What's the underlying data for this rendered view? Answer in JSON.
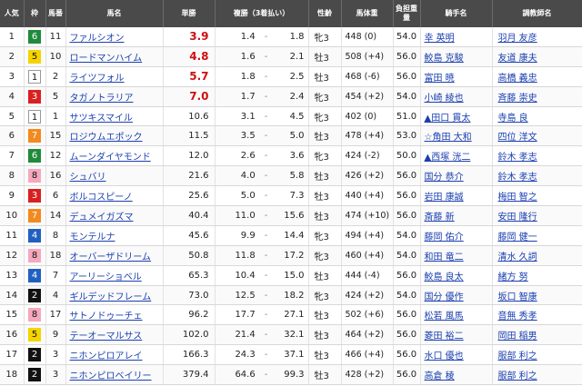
{
  "headers": {
    "rank": "人気",
    "waku": "枠",
    "umaban": "馬番",
    "horse": "馬名",
    "win": "単勝",
    "place": "複勝（3着払い）",
    "sex_age": "性齢",
    "weight": "馬体重",
    "kinryo": "負担重量",
    "jockey": "騎手名",
    "trainer": "調教師名"
  },
  "colors": {
    "waku1": "#ffffff",
    "waku2": "#111111",
    "waku3": "#d92020",
    "waku4": "#2060c0",
    "waku5": "#f5d300",
    "waku6": "#1f8a3a",
    "waku7": "#f28a1e",
    "waku8": "#f5a8be",
    "header_bg": "#4a4a4a",
    "odds_red": "#cc1111",
    "link": "#1a3fb0"
  },
  "rows": [
    {
      "rank": "1",
      "waku": "6",
      "umaban": "11",
      "horse": "ファルシオン",
      "win": "3.9",
      "place_lo": "1.4",
      "place_hi": "1.8",
      "sex_age": "牝3",
      "weight": "448 (0)",
      "kinryo": "54.0",
      "jockey": "幸 英明",
      "trainer": "羽月 友彦"
    },
    {
      "rank": "2",
      "waku": "5",
      "umaban": "10",
      "horse": "ロードマンハイム",
      "win": "4.8",
      "place_lo": "1.6",
      "place_hi": "2.1",
      "sex_age": "牡3",
      "weight": "508 (+4)",
      "kinryo": "56.0",
      "jockey": "鮫島 克駿",
      "trainer": "友道 康夫"
    },
    {
      "rank": "3",
      "waku": "1",
      "umaban": "2",
      "horse": "ライツフォル",
      "win": "5.7",
      "place_lo": "1.8",
      "place_hi": "2.5",
      "sex_age": "牡3",
      "weight": "468 (-6)",
      "kinryo": "56.0",
      "jockey": "富田 暁",
      "trainer": "高橋 義忠"
    },
    {
      "rank": "4",
      "waku": "3",
      "umaban": "5",
      "horse": "タガノトラリア",
      "win": "7.0",
      "place_lo": "1.7",
      "place_hi": "2.4",
      "sex_age": "牝3",
      "weight": "454 (+2)",
      "kinryo": "54.0",
      "jockey": "小崎 綾也",
      "trainer": "斉藤 崇史"
    },
    {
      "rank": "5",
      "waku": "1",
      "umaban": "1",
      "horse": "サツキスマイル",
      "win": "10.6",
      "place_lo": "3.1",
      "place_hi": "4.5",
      "sex_age": "牝3",
      "weight": "402 (0)",
      "kinryo": "51.0",
      "jockey": "▲田口 貫太",
      "trainer": "寺島 良"
    },
    {
      "rank": "6",
      "waku": "7",
      "umaban": "15",
      "horse": "ロジウムエポック",
      "win": "11.5",
      "place_lo": "3.5",
      "place_hi": "5.0",
      "sex_age": "牡3",
      "weight": "478 (+4)",
      "kinryo": "53.0",
      "jockey": "☆角田 大和",
      "trainer": "四位 洋文"
    },
    {
      "rank": "7",
      "waku": "6",
      "umaban": "12",
      "horse": "ムーンダイヤモンド",
      "win": "12.0",
      "place_lo": "2.6",
      "place_hi": "3.6",
      "sex_age": "牝3",
      "weight": "424 (-2)",
      "kinryo": "50.0",
      "jockey": "▲西塚 洸二",
      "trainer": "鈴木 孝志"
    },
    {
      "rank": "8",
      "waku": "8",
      "umaban": "16",
      "horse": "シュバリ",
      "win": "21.6",
      "place_lo": "4.0",
      "place_hi": "5.8",
      "sex_age": "牡3",
      "weight": "426 (+2)",
      "kinryo": "56.0",
      "jockey": "国分 恭介",
      "trainer": "鈴木 孝志"
    },
    {
      "rank": "9",
      "waku": "3",
      "umaban": "6",
      "horse": "ボルコスピーノ",
      "win": "25.6",
      "place_lo": "5.0",
      "place_hi": "7.3",
      "sex_age": "牡3",
      "weight": "440 (+4)",
      "kinryo": "56.0",
      "jockey": "岩田 康誠",
      "trainer": "梅田 智之"
    },
    {
      "rank": "10",
      "waku": "7",
      "umaban": "14",
      "horse": "デュメイガズマ",
      "win": "40.4",
      "place_lo": "11.0",
      "place_hi": "15.6",
      "sex_age": "牡3",
      "weight": "474 (+10)",
      "kinryo": "56.0",
      "jockey": "斎藤 新",
      "trainer": "安田 隆行"
    },
    {
      "rank": "11",
      "waku": "4",
      "umaban": "8",
      "horse": "モンテルナ",
      "win": "45.6",
      "place_lo": "9.9",
      "place_hi": "14.4",
      "sex_age": "牝3",
      "weight": "494 (+4)",
      "kinryo": "54.0",
      "jockey": "藤岡 佑介",
      "trainer": "藤岡 健一"
    },
    {
      "rank": "12",
      "waku": "8",
      "umaban": "18",
      "horse": "オーバーザドリーム",
      "win": "50.8",
      "place_lo": "11.8",
      "place_hi": "17.2",
      "sex_age": "牝3",
      "weight": "460 (+4)",
      "kinryo": "54.0",
      "jockey": "和田 竜二",
      "trainer": "清水 久詞"
    },
    {
      "rank": "13",
      "waku": "4",
      "umaban": "7",
      "horse": "アーリーショベル",
      "win": "65.3",
      "place_lo": "10.4",
      "place_hi": "15.0",
      "sex_age": "牡3",
      "weight": "444 (-4)",
      "kinryo": "56.0",
      "jockey": "鮫島 良太",
      "trainer": "緒方 努"
    },
    {
      "rank": "14",
      "waku": "2",
      "umaban": "4",
      "horse": "ギルデッドフレーム",
      "win": "73.0",
      "place_lo": "12.5",
      "place_hi": "18.2",
      "sex_age": "牝3",
      "weight": "424 (+2)",
      "kinryo": "54.0",
      "jockey": "国分 優作",
      "trainer": "坂口 智康"
    },
    {
      "rank": "15",
      "waku": "8",
      "umaban": "17",
      "horse": "サトノドゥーチェ",
      "win": "96.2",
      "place_lo": "17.7",
      "place_hi": "27.1",
      "sex_age": "牡3",
      "weight": "502 (+6)",
      "kinryo": "56.0",
      "jockey": "松若 風馬",
      "trainer": "音無 秀孝"
    },
    {
      "rank": "16",
      "waku": "5",
      "umaban": "9",
      "horse": "テーオーマルサス",
      "win": "102.0",
      "place_lo": "21.4",
      "place_hi": "32.1",
      "sex_age": "牡3",
      "weight": "464 (+2)",
      "kinryo": "56.0",
      "jockey": "菱田 裕二",
      "trainer": "岡田 稲男"
    },
    {
      "rank": "17",
      "waku": "2",
      "umaban": "3",
      "horse": "ニホンピロアレイ",
      "win": "166.3",
      "place_lo": "24.3",
      "place_hi": "37.1",
      "sex_age": "牡3",
      "weight": "466 (+4)",
      "kinryo": "56.0",
      "jockey": "水口 優也",
      "trainer": "服部 利之"
    },
    {
      "rank": "18",
      "waku": "2",
      "umaban": "3",
      "horse": "ニホンピロベイリー",
      "win": "379.4",
      "place_lo": "64.6",
      "place_hi": "99.3",
      "sex_age": "牡3",
      "weight": "428 (+2)",
      "kinryo": "56.0",
      "jockey": "高倉 稜",
      "trainer": "服部 利之"
    }
  ]
}
